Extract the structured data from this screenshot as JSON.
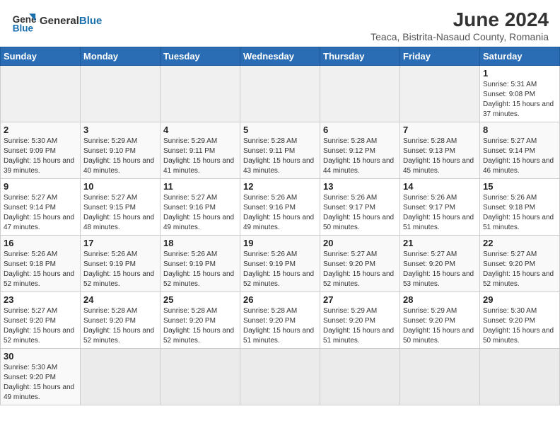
{
  "header": {
    "logo_general": "General",
    "logo_blue": "Blue",
    "month_year": "June 2024",
    "location": "Teaca, Bistrita-Nasaud County, Romania"
  },
  "weekdays": [
    "Sunday",
    "Monday",
    "Tuesday",
    "Wednesday",
    "Thursday",
    "Friday",
    "Saturday"
  ],
  "weeks": [
    [
      {
        "day": null
      },
      {
        "day": null
      },
      {
        "day": null
      },
      {
        "day": null
      },
      {
        "day": null
      },
      {
        "day": null
      },
      {
        "day": 1,
        "sunrise": "5:31 AM",
        "sunset": "9:08 PM",
        "daylight": "15 hours and 37 minutes."
      }
    ],
    [
      {
        "day": 2,
        "sunrise": "5:30 AM",
        "sunset": "9:09 PM",
        "daylight": "15 hours and 39 minutes."
      },
      {
        "day": 3,
        "sunrise": "5:29 AM",
        "sunset": "9:10 PM",
        "daylight": "15 hours and 40 minutes."
      },
      {
        "day": 4,
        "sunrise": "5:29 AM",
        "sunset": "9:11 PM",
        "daylight": "15 hours and 41 minutes."
      },
      {
        "day": 5,
        "sunrise": "5:28 AM",
        "sunset": "9:11 PM",
        "daylight": "15 hours and 43 minutes."
      },
      {
        "day": 6,
        "sunrise": "5:28 AM",
        "sunset": "9:12 PM",
        "daylight": "15 hours and 44 minutes."
      },
      {
        "day": 7,
        "sunrise": "5:28 AM",
        "sunset": "9:13 PM",
        "daylight": "15 hours and 45 minutes."
      },
      {
        "day": 8,
        "sunrise": "5:27 AM",
        "sunset": "9:14 PM",
        "daylight": "15 hours and 46 minutes."
      }
    ],
    [
      {
        "day": 9,
        "sunrise": "5:27 AM",
        "sunset": "9:14 PM",
        "daylight": "15 hours and 47 minutes."
      },
      {
        "day": 10,
        "sunrise": "5:27 AM",
        "sunset": "9:15 PM",
        "daylight": "15 hours and 48 minutes."
      },
      {
        "day": 11,
        "sunrise": "5:27 AM",
        "sunset": "9:16 PM",
        "daylight": "15 hours and 49 minutes."
      },
      {
        "day": 12,
        "sunrise": "5:26 AM",
        "sunset": "9:16 PM",
        "daylight": "15 hours and 49 minutes."
      },
      {
        "day": 13,
        "sunrise": "5:26 AM",
        "sunset": "9:17 PM",
        "daylight": "15 hours and 50 minutes."
      },
      {
        "day": 14,
        "sunrise": "5:26 AM",
        "sunset": "9:17 PM",
        "daylight": "15 hours and 51 minutes."
      },
      {
        "day": 15,
        "sunrise": "5:26 AM",
        "sunset": "9:18 PM",
        "daylight": "15 hours and 51 minutes."
      }
    ],
    [
      {
        "day": 16,
        "sunrise": "5:26 AM",
        "sunset": "9:18 PM",
        "daylight": "15 hours and 52 minutes."
      },
      {
        "day": 17,
        "sunrise": "5:26 AM",
        "sunset": "9:19 PM",
        "daylight": "15 hours and 52 minutes."
      },
      {
        "day": 18,
        "sunrise": "5:26 AM",
        "sunset": "9:19 PM",
        "daylight": "15 hours and 52 minutes."
      },
      {
        "day": 19,
        "sunrise": "5:26 AM",
        "sunset": "9:19 PM",
        "daylight": "15 hours and 52 minutes."
      },
      {
        "day": 20,
        "sunrise": "5:27 AM",
        "sunset": "9:20 PM",
        "daylight": "15 hours and 52 minutes."
      },
      {
        "day": 21,
        "sunrise": "5:27 AM",
        "sunset": "9:20 PM",
        "daylight": "15 hours and 53 minutes."
      },
      {
        "day": 22,
        "sunrise": "5:27 AM",
        "sunset": "9:20 PM",
        "daylight": "15 hours and 52 minutes."
      }
    ],
    [
      {
        "day": 23,
        "sunrise": "5:27 AM",
        "sunset": "9:20 PM",
        "daylight": "15 hours and 52 minutes."
      },
      {
        "day": 24,
        "sunrise": "5:28 AM",
        "sunset": "9:20 PM",
        "daylight": "15 hours and 52 minutes."
      },
      {
        "day": 25,
        "sunrise": "5:28 AM",
        "sunset": "9:20 PM",
        "daylight": "15 hours and 52 minutes."
      },
      {
        "day": 26,
        "sunrise": "5:28 AM",
        "sunset": "9:20 PM",
        "daylight": "15 hours and 51 minutes."
      },
      {
        "day": 27,
        "sunrise": "5:29 AM",
        "sunset": "9:20 PM",
        "daylight": "15 hours and 51 minutes."
      },
      {
        "day": 28,
        "sunrise": "5:29 AM",
        "sunset": "9:20 PM",
        "daylight": "15 hours and 50 minutes."
      },
      {
        "day": 29,
        "sunrise": "5:30 AM",
        "sunset": "9:20 PM",
        "daylight": "15 hours and 50 minutes."
      }
    ],
    [
      {
        "day": 30,
        "sunrise": "5:30 AM",
        "sunset": "9:20 PM",
        "daylight": "15 hours and 49 minutes."
      },
      {
        "day": null
      },
      {
        "day": null
      },
      {
        "day": null
      },
      {
        "day": null
      },
      {
        "day": null
      },
      {
        "day": null
      }
    ]
  ]
}
